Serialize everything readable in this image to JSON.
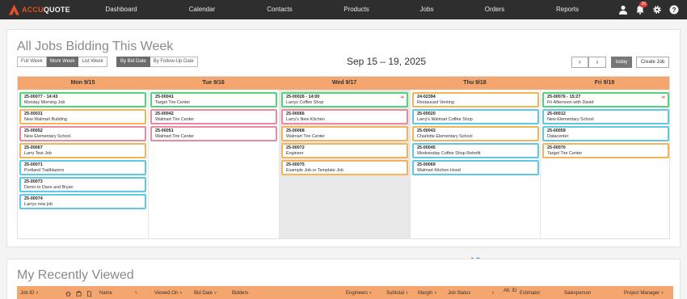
{
  "app": {
    "logo_a": "ACCU",
    "logo_b": "QUOTE",
    "nav": [
      "Dashboard",
      "Calendar",
      "Contacts",
      "Products",
      "Jobs",
      "Orders",
      "Reports"
    ],
    "notification_count": "26"
  },
  "calendar": {
    "title": "All Jobs Bidding This Week",
    "range_label": "Sep 15 – 19, 2025",
    "view_buttons": [
      "Full Week",
      "Work Week",
      "List Week"
    ],
    "active_view": "Work Week",
    "sort_buttons": [
      "By Bid Date",
      "By Follow-Up Date"
    ],
    "active_sort": "By Bid Date",
    "prev_label": "‹",
    "next_label": "›",
    "today_label": "today",
    "create_label": "Create Job",
    "days": [
      {
        "label": "Mon 9/15",
        "jobs": [
          {
            "id": "25-00077 - 14:43",
            "name": "Monday Morning Job",
            "color": "#53d37a"
          },
          {
            "id": "25-00031",
            "name": "New Walmart Building",
            "color": "#f2b459"
          },
          {
            "id": "25-00052",
            "name": "New Elementary School",
            "color": "#ea8aa0"
          },
          {
            "id": "25-00067",
            "name": "Larry Test Job",
            "color": "#f2b459"
          },
          {
            "id": "25-00071",
            "name": "Portland Trailblazers",
            "color": "#5ec9e5"
          },
          {
            "id": "25-00073",
            "name": "Demo to Dave and Bryan",
            "color": "#5ec9e5"
          },
          {
            "id": "25-00074",
            "name": "Larrys new job",
            "color": "#5ec9e5"
          }
        ]
      },
      {
        "label": "Tue 9/16",
        "jobs": [
          {
            "id": "25-00041",
            "name": "Target Tire Center",
            "color": "#53d37a"
          },
          {
            "id": "25-00042",
            "name": "Walmart Tire Center",
            "color": "#ea8aa0"
          },
          {
            "id": "25-00051",
            "name": "Walmart Tire Center",
            "color": "#ea8aa0"
          }
        ]
      },
      {
        "label": "Wed 9/17",
        "jobs": [
          {
            "id": "25-00026 - 14:00",
            "name": "Larrys Coffee Shop",
            "color": "#53d37a",
            "arrow": true
          },
          {
            "id": "25-00066",
            "name": "Larry's New Kitchen",
            "color": "#ea8aa0"
          },
          {
            "id": "25-00068",
            "name": "Walmart Tire Center",
            "color": "#f2b459"
          },
          {
            "id": "25-00072",
            "name": "Engineer",
            "color": "#f2b459"
          },
          {
            "id": "25-00075",
            "name": "Example Job or Template Job",
            "color": "#f2b459"
          }
        ]
      },
      {
        "label": "Thu 9/18",
        "jobs": [
          {
            "id": "24-02394",
            "name": "Restaurant Venting",
            "color": "#f2b459"
          },
          {
            "id": "25-00020",
            "name": "Larry's Walmart Coffee Shop",
            "color": "#5ec9e5"
          },
          {
            "id": "25-00043",
            "name": "Charlotte Elementary School",
            "color": "#f2b459"
          },
          {
            "id": "25-00045",
            "name": "Wednesday Coffee Shop Retrofit",
            "color": "#5ec9e5"
          },
          {
            "id": "25-00069",
            "name": "Walmart Kitchen Hood",
            "color": "#5ec9e5"
          }
        ]
      },
      {
        "label": "Fri 9/19",
        "jobs": [
          {
            "id": "25-00076 - 15:27",
            "name": "Fri Afternoon with David",
            "color": "#53d37a",
            "arrow": true
          },
          {
            "id": "25-00012",
            "name": "New Elementary School",
            "color": "#5ec9e5"
          },
          {
            "id": "25-00059",
            "name": "Datacenter",
            "color": "#5ec9e5"
          },
          {
            "id": "25-00070",
            "name": "Target Tire Center",
            "color": "#f2b459"
          }
        ]
      }
    ]
  },
  "recent": {
    "title": "My Recently Viewed",
    "columns": [
      {
        "label": "Job ID",
        "sort": "˅"
      },
      {
        "label": "Name",
        "sort": "˅"
      },
      {
        "label": "Viewed On",
        "sort": "˄"
      },
      {
        "label": "Bid Date",
        "sort": "˅"
      },
      {
        "label": "Bidders",
        "sort": ""
      },
      {
        "label": "Engineers",
        "sort": "˅"
      },
      {
        "label": "Subtotal",
        "sort": "˅"
      },
      {
        "label": "Margin",
        "sort": "˅"
      },
      {
        "label": "Job Status",
        "sort": "˅"
      },
      {
        "label": "Alt. ID",
        "sort": ""
      },
      {
        "label": "Estimator",
        "sort": ""
      },
      {
        "label": "Salesperson",
        "sort": ""
      },
      {
        "label": "Project Manager",
        "sort": "˅"
      }
    ]
  }
}
